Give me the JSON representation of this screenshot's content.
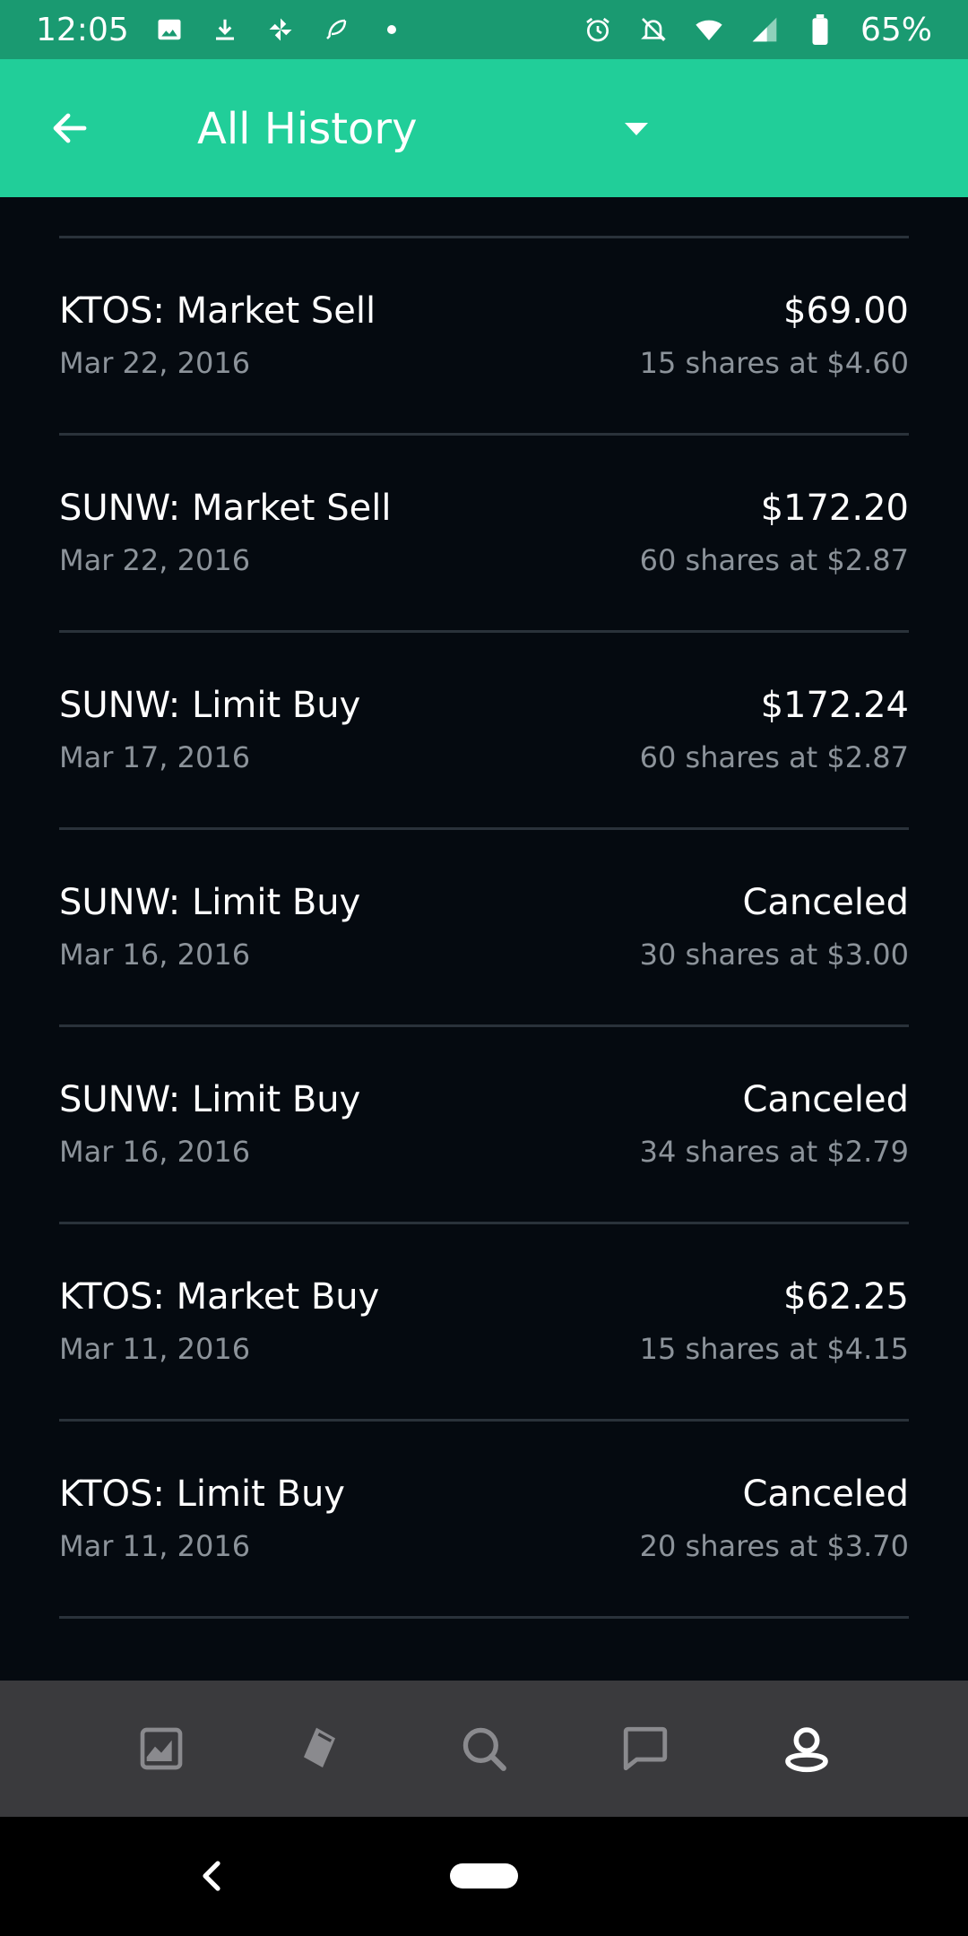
{
  "status_bar": {
    "time": "12:05",
    "battery": "65%",
    "colors": {
      "background": "#1a9a71"
    }
  },
  "app_bar": {
    "title": "All History",
    "colors": {
      "background": "#21ce99"
    }
  },
  "history": [
    {
      "title": "KTOS: Market Sell",
      "date": "Mar 22, 2016",
      "amount": "$69.00",
      "detail": "15 shares at $4.60"
    },
    {
      "title": "SUNW: Market Sell",
      "date": "Mar 22, 2016",
      "amount": "$172.20",
      "detail": "60 shares at $2.87"
    },
    {
      "title": "SUNW: Limit Buy",
      "date": "Mar 17, 2016",
      "amount": "$172.24",
      "detail": "60 shares at $2.87"
    },
    {
      "title": "SUNW: Limit Buy",
      "date": "Mar 16, 2016",
      "amount": "Canceled",
      "detail": "30 shares at $3.00"
    },
    {
      "title": "SUNW: Limit Buy",
      "date": "Mar 16, 2016",
      "amount": "Canceled",
      "detail": "34 shares at $2.79"
    },
    {
      "title": "KTOS: Market Buy",
      "date": "Mar 11, 2016",
      "amount": "$62.25",
      "detail": "15 shares at $4.15"
    },
    {
      "title": "KTOS: Limit Buy",
      "date": "Mar 11, 2016",
      "amount": "Canceled",
      "detail": "20 shares at $3.70"
    }
  ],
  "bottom_nav": {
    "items": [
      {
        "icon": "portfolio-chart-icon",
        "active": false
      },
      {
        "icon": "ticket-icon",
        "active": false
      },
      {
        "icon": "search-icon",
        "active": false
      },
      {
        "icon": "messages-icon",
        "active": false
      },
      {
        "icon": "account-icon",
        "active": true
      }
    ]
  }
}
